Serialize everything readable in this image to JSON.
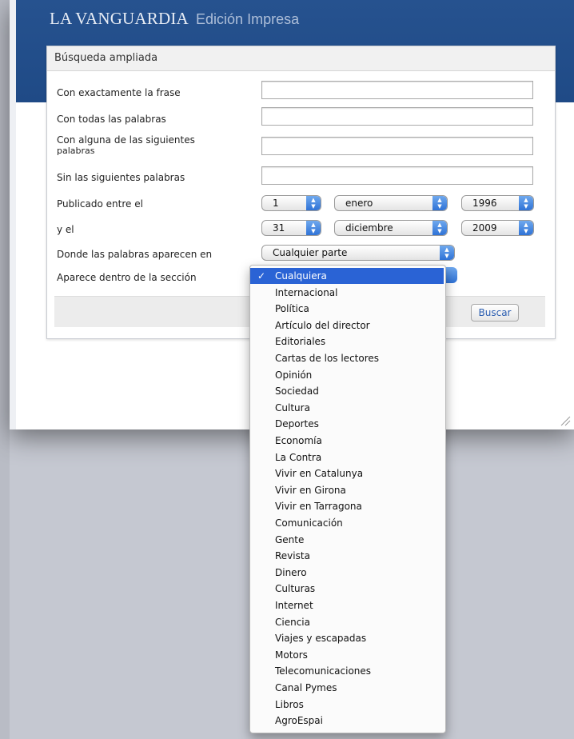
{
  "header": {
    "brand_main": "LA VANGUARDIA",
    "brand_sub": "Edición Impresa"
  },
  "dialog": {
    "title": "Búsqueda ampliada",
    "labels": {
      "exact_phrase": "Con exactamente la frase",
      "all_words": "Con todas las palabras",
      "any_words_line1": "Con alguna de las siguientes",
      "any_words_line2": "palabras",
      "without_words": "Sin las siguientes palabras",
      "published_between": "Publicado entre el",
      "and": "y el",
      "where_words": "Donde las palabras aparecen en",
      "section": "Aparece dentro de la sección"
    },
    "inputs": {
      "exact_phrase": "",
      "all_words": "",
      "any_words": "",
      "without_words": ""
    },
    "from_date": {
      "day": "1",
      "month": "enero",
      "year": "1996"
    },
    "to_date": {
      "day": "31",
      "month": "diciembre",
      "year": "2009"
    },
    "where_value": "Cualquier parte",
    "search_button": "Buscar"
  },
  "section_dropdown": {
    "selected_index": 0,
    "check_glyph": "✓",
    "options": [
      "Cualquiera",
      "Internacional",
      "Política",
      "Artículo del director",
      "Editoriales",
      "Cartas de los lectores",
      "Opinión",
      "Sociedad",
      "Cultura",
      "Deportes",
      "Economía",
      "La Contra",
      "Vivir en Catalunya",
      "Vivir en Girona",
      "Vivir en Tarragona",
      "Comunicación",
      "Gente",
      "Revista",
      "Dinero",
      "Culturas",
      "Internet",
      "Ciencia",
      "Viajes y escapadas",
      "Motors",
      "Telecomunicaciones",
      "Canal Pymes",
      "Libros",
      "AgroEspai"
    ]
  },
  "colors": {
    "masthead": "#26528f",
    "selection": "#2a63d5",
    "stepper": "#2f72d6"
  }
}
